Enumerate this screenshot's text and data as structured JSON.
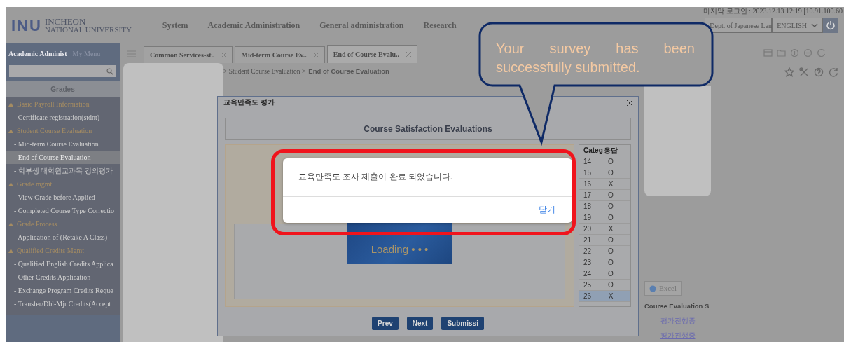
{
  "header": {
    "logo_letters": "INU",
    "logo_line1": "INCHEON",
    "logo_line2": "NATIONAL UNIVERSITY",
    "menus": [
      "System",
      "Academic Administration",
      "General administration",
      "Research"
    ],
    "last_login": "마지막 로그인 : 2023.12.13 12:19 [10.91.100.60",
    "dept_select": "Dept. of Japanese Lan",
    "language_select": "ENGLISH"
  },
  "sidebar": {
    "tabs": [
      {
        "label": "Academic Administ",
        "selected": true
      },
      {
        "label": "My Menu",
        "selected": false
      }
    ],
    "title": "Grades",
    "items": [
      {
        "kind": "group",
        "label": "Basic Payroll Information",
        "selected": false
      },
      {
        "kind": "item",
        "label": "- Certificate registration(stdnt)",
        "selected": false
      },
      {
        "kind": "group",
        "label": "Student Course Evaluation",
        "selected": false
      },
      {
        "kind": "item",
        "label": "- Mid-term Course Evaluation",
        "selected": false
      },
      {
        "kind": "item",
        "label": "- End of Course Evaluation",
        "selected": true
      },
      {
        "kind": "item",
        "label": "- 학부생 대학원교과목 강의평가",
        "selected": false
      },
      {
        "kind": "group",
        "label": "Grade mgmt",
        "selected": false
      },
      {
        "kind": "item",
        "label": "- View Grade before Applied",
        "selected": false
      },
      {
        "kind": "item",
        "label": "- Completed Course Type Correctio",
        "selected": false
      },
      {
        "kind": "group",
        "label": "Grade Process",
        "selected": false
      },
      {
        "kind": "item",
        "label": "- Application of (Retake A Class)",
        "selected": false
      },
      {
        "kind": "group",
        "label": "Qualified Credits Mgmt",
        "selected": false
      },
      {
        "kind": "item",
        "label": "- Qualified English Credits Applica",
        "selected": false
      },
      {
        "kind": "item",
        "label": "- Other Credits Application",
        "selected": false
      },
      {
        "kind": "item",
        "label": "- Exchange Program Credits Reque",
        "selected": false
      },
      {
        "kind": "item",
        "label": "- Transfer/Dbl-Mjr Credits(Accept",
        "selected": false
      }
    ]
  },
  "tabs": [
    {
      "label": "Common Services-st..",
      "selected": false
    },
    {
      "label": "Mid-term Course Ev..",
      "selected": false
    },
    {
      "label": "End of Course Evalu..",
      "selected": true
    }
  ],
  "breadcrumb": {
    "path": "> Student Course Evaluation >",
    "current": "End of Course Evaluation"
  },
  "background_panel": {
    "button": "Excel",
    "section_title": "Course Evaluation S",
    "links": [
      "평가진행중",
      "평가진행중"
    ]
  },
  "modal": {
    "title": "교육만족도 평가",
    "heading": "Course Satisfaction Evaluations",
    "loading": "Loading • • •",
    "buttons": [
      "Prev",
      "Next",
      "Submissi"
    ],
    "columns": [
      "Categ",
      "응답"
    ],
    "answers": [
      {
        "number": "14",
        "answer": "O",
        "selected": false
      },
      {
        "number": "15",
        "answer": "O",
        "selected": false
      },
      {
        "number": "16",
        "answer": "X",
        "selected": false
      },
      {
        "number": "17",
        "answer": "O",
        "selected": false
      },
      {
        "number": "18",
        "answer": "O",
        "selected": false
      },
      {
        "number": "19",
        "answer": "O",
        "selected": false
      },
      {
        "number": "20",
        "answer": "X",
        "selected": false
      },
      {
        "number": "21",
        "answer": "O",
        "selected": false
      },
      {
        "number": "22",
        "answer": "O",
        "selected": false
      },
      {
        "number": "23",
        "answer": "O",
        "selected": false
      },
      {
        "number": "24",
        "answer": "O",
        "selected": false
      },
      {
        "number": "25",
        "answer": "O",
        "selected": false
      },
      {
        "number": "26",
        "answer": "X",
        "selected": true
      }
    ]
  },
  "alert": {
    "message": "교육만족도 조사 제출이 완료 되었습니다.",
    "button": "닫기"
  },
  "callout": {
    "text": "Your survey has been successfully submitted."
  }
}
